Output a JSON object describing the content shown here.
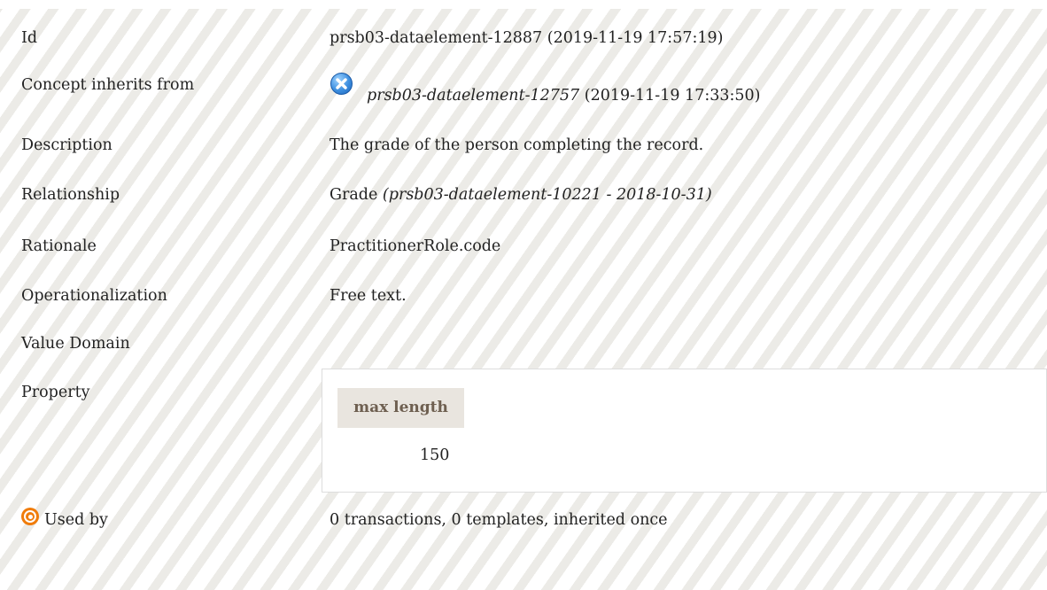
{
  "rows": {
    "id": {
      "label": "Id",
      "value": "prsb03-dataelement-12887 (2019-11-19 17:57:19)"
    },
    "inherits": {
      "label": "Concept inherits from",
      "ref": "prsb03-dataelement-12757",
      "date": "(2019-11-19 17:33:50)",
      "icon": "inherit-badge-icon"
    },
    "description": {
      "label": "Description",
      "value": "The grade of the person completing the record."
    },
    "relationship": {
      "label": "Relationship",
      "value": "Grade",
      "ref": "(prsb03-dataelement-10221 - 2018-10-31)"
    },
    "rationale": {
      "label": "Rationale",
      "value": "PractitionerRole.code"
    },
    "operationalization": {
      "label": "Operationalization",
      "value": "Free text."
    },
    "value_domain": {
      "label": "Value Domain"
    },
    "property": {
      "label": "Property",
      "header": "max length",
      "value": "150"
    },
    "used_by": {
      "label": "Used by",
      "value": "0 transactions, 0 templates, inherited once",
      "icon": "target-icon"
    }
  },
  "colors": {
    "icon_blue": "#3d8fe0",
    "icon_orange": "#f07c0a",
    "property_header_bg": "#e9e5df",
    "property_header_text": "#6e5f50"
  }
}
